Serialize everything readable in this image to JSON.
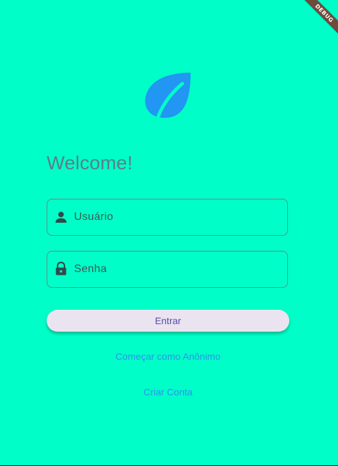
{
  "debug_banner": "DEBUG",
  "logo": {
    "icon": "leaf-icon",
    "color": "#2196f3"
  },
  "welcome": "Welcome!",
  "username_field": {
    "placeholder": "Usuário",
    "icon": "person-icon"
  },
  "password_field": {
    "placeholder": "Senha",
    "icon": "lock-icon"
  },
  "buttons": {
    "enter": "Entrar",
    "anonymous": "Começar como Anônimo",
    "create_account": "Criar Conta"
  },
  "colors": {
    "background": "#00ffc8",
    "accent": "#2196f3",
    "welcome_text": "#5b7e86"
  }
}
